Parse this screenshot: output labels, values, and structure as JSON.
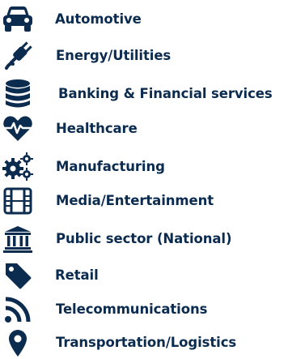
{
  "industries": [
    {
      "label": "Automotive",
      "icon": "car-icon"
    },
    {
      "label": "Energy/Utilities",
      "icon": "plug-icon"
    },
    {
      "label": "Banking & Financial services",
      "icon": "database-icon"
    },
    {
      "label": "Healthcare",
      "icon": "heartbeat-icon"
    },
    {
      "label": "Manufacturing",
      "icon": "gears-icon"
    },
    {
      "label": "Media/Entertainment",
      "icon": "film-icon"
    },
    {
      "label": "Public sector (National)",
      "icon": "bank-building-icon"
    },
    {
      "label": "Retail",
      "icon": "price-tag-icon"
    },
    {
      "label": "Telecommunications",
      "icon": "rss-feed-icon"
    },
    {
      "label": "Transportation/Logistics",
      "icon": "map-marker-icon"
    }
  ],
  "colors": {
    "icon": "#0b2b4f",
    "text": "#0b2b4f",
    "background": "#ffffff"
  }
}
